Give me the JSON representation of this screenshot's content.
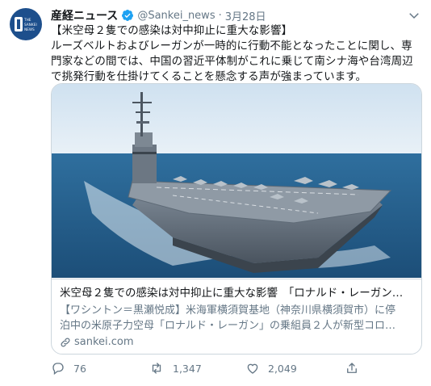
{
  "account": {
    "name": "産経ニュース",
    "handle": "@Sankei_news",
    "separator": "·",
    "date": "3月28日",
    "avatar_lines": [
      "THE",
      "SANKEI",
      "NEWS"
    ]
  },
  "tweet": {
    "lines": [
      "【米空母２隻での感染は対中抑止に重大な影響】",
      "ルーズベルトおよびレーガンが一時的に行動不能となったことに関し、専",
      "門家などの間では、中国の習近平体制がこれに乗じて南シナ海や台湾周辺",
      "で挑発行動を仕掛けてくることを懸念する声が強まっています。"
    ]
  },
  "card": {
    "title": "米空母２隻での感染は対中抑止に重大な影響　「ロナルド・レーガン…",
    "description_lines": [
      "【ワシントン＝黒瀬悦成】米海軍横須賀基地（神奈川県横須賀市）に停",
      "泊中の米原子力空母「ロナルド・レーガン」の乗組員２人が新型コロ…"
    ],
    "domain": "sankei.com"
  },
  "actions": {
    "replies": "76",
    "retweets": "1,347",
    "likes": "2,049"
  },
  "colors": {
    "accent": "#1da1f2",
    "secondary_text": "#657786",
    "avatar_bg": "#1d4f8c"
  },
  "icons": [
    "verified-icon",
    "chevron-down-icon",
    "link-icon",
    "reply-icon",
    "retweet-icon",
    "like-icon",
    "share-icon"
  ]
}
